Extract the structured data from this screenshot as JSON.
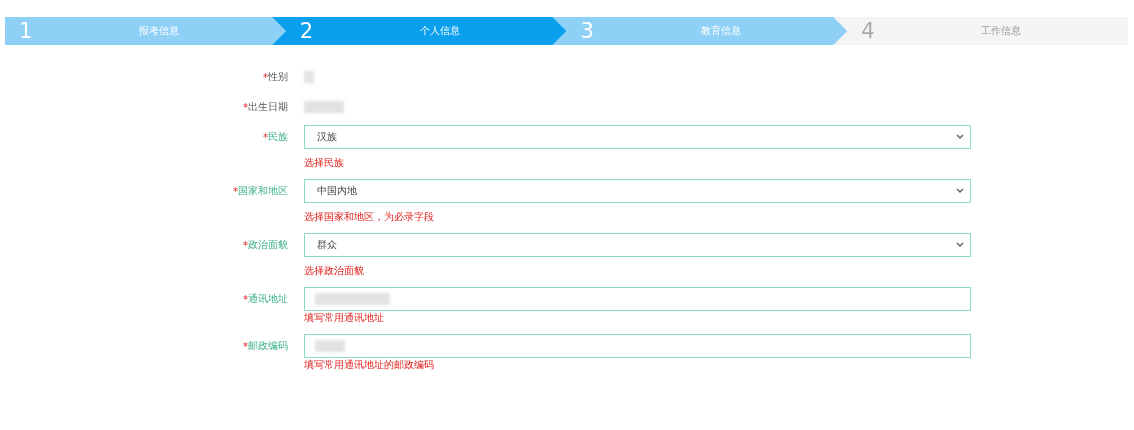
{
  "steps": [
    {
      "number": "1",
      "label": "报考信息",
      "selected": false,
      "reached": true
    },
    {
      "number": "2",
      "label": "个人信息",
      "selected": true,
      "reached": true
    },
    {
      "number": "3",
      "label": "教育信息",
      "selected": false,
      "reached": true
    },
    {
      "number": "4",
      "label": "工作信息",
      "selected": false,
      "reached": false
    }
  ],
  "fields": [
    {
      "kind": "static",
      "required_mark": "*",
      "label": "性别"
    },
    {
      "kind": "static",
      "required_mark": "*",
      "label": "出生日期"
    },
    {
      "kind": "select",
      "required_mark": "*",
      "label": "民族",
      "value": "汉族",
      "hint": "选择民族"
    },
    {
      "kind": "select",
      "required_mark": "*",
      "label": "国家和地区",
      "value": "中国内地",
      "hint": "选择国家和地区，为必录字段"
    },
    {
      "kind": "select",
      "required_mark": "*",
      "label": "政治面貌",
      "value": "群众",
      "hint": "选择政治面貌"
    },
    {
      "kind": "text",
      "required_mark": "*",
      "label": "通讯地址",
      "hint": "填写常用通讯地址"
    },
    {
      "kind": "text",
      "required_mark": "*",
      "label": "邮政编码",
      "hint": "填写常用通讯地址的邮政编码"
    }
  ]
}
